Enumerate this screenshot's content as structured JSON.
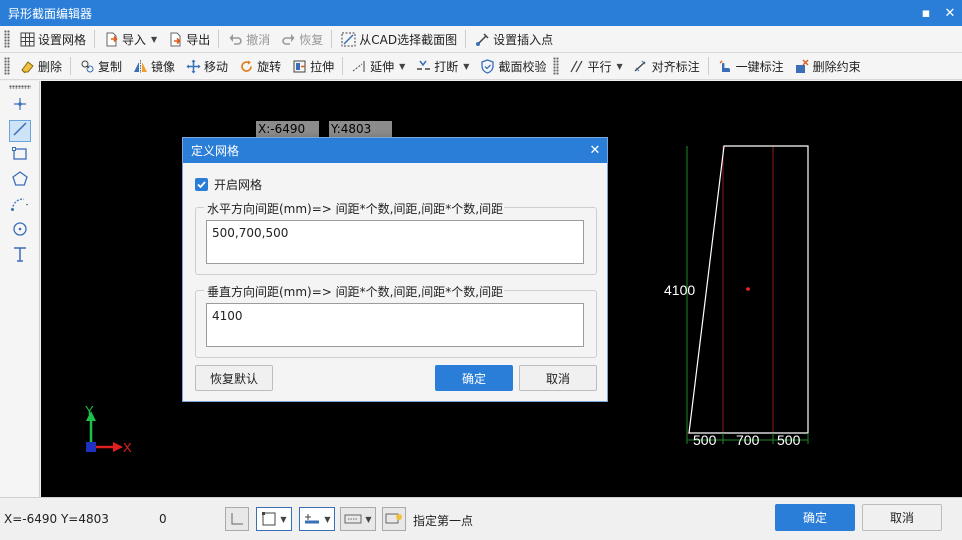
{
  "window": {
    "title": "异形截面编辑器",
    "min": "▪",
    "close": "✕"
  },
  "toolbar1": {
    "grid": "设置网格",
    "import": "导入",
    "export": "导出",
    "undo": "撤消",
    "redo": "恢复",
    "from_cad": "从CAD选择截面图",
    "insert_point": "设置插入点"
  },
  "toolbar2": {
    "delete": "删除",
    "copy": "复制",
    "mirror": "镜像",
    "move": "移动",
    "rotate": "旋转",
    "stretch": "拉伸",
    "extend": "延伸",
    "break": "打断",
    "check": "截面校验",
    "parallel": "平行",
    "align_dim": "对齐标注",
    "one_key_dim": "一键标注",
    "delete_constraint": "删除约束"
  },
  "canvas": {
    "coord_x": "X:-6490",
    "coord_y": "Y:4803",
    "dims": {
      "vertical": "4100",
      "h1": "500",
      "h2": "700",
      "h3": "500"
    },
    "axis_x": "X",
    "axis_y": "Y"
  },
  "dialog": {
    "title": "定义网格",
    "enable_label": "开启网格",
    "enabled": true,
    "h_label": "水平方向间距(mm)=> 间距*个数,间距,间距*个数,间距,...",
    "h_value": "500,700,500",
    "v_label": "垂直方向间距(mm)=> 间距*个数,间距,间距*个数,间距,...",
    "v_value": "4100",
    "restore": "恢复默认",
    "ok": "确定",
    "cancel": "取消"
  },
  "status": {
    "coord": "X=-6490 Y=4803",
    "value": "0",
    "hint": "指定第一点",
    "ok": "确定",
    "cancel": "取消"
  }
}
